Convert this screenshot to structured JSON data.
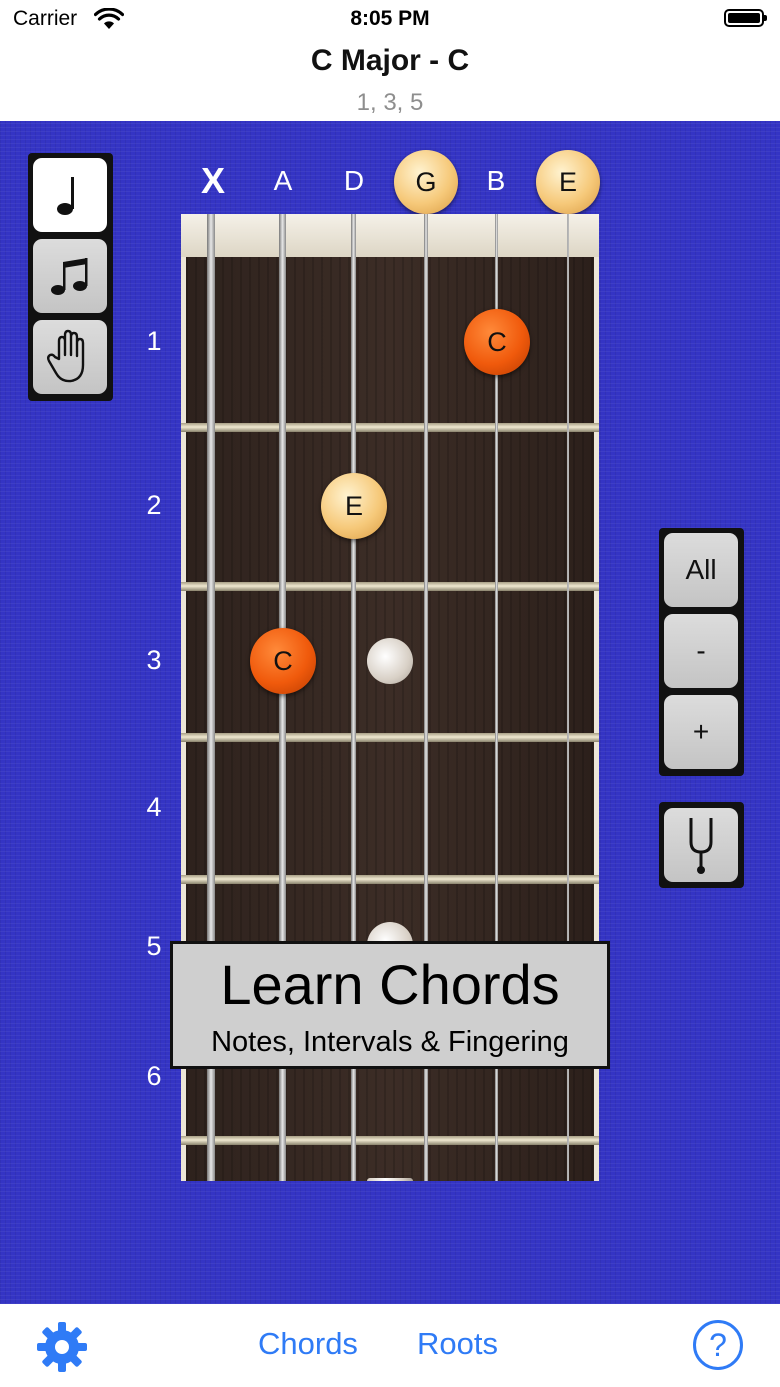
{
  "status_bar": {
    "carrier": "Carrier",
    "time": "8:05 PM"
  },
  "header": {
    "title": "C Major - C",
    "intervals": "1, 3, 5"
  },
  "strings": {
    "labels": [
      "A",
      "D",
      "B"
    ],
    "muted": "X"
  },
  "open_notes": [
    "G",
    "E"
  ],
  "fret_numbers": [
    "1",
    "2",
    "3",
    "4",
    "5",
    "6"
  ],
  "notes": [
    {
      "label": "C",
      "string": "B",
      "fret": 1,
      "role": "root"
    },
    {
      "label": "E",
      "string": "D",
      "fret": 2,
      "role": "third"
    },
    {
      "label": "C",
      "string": "A",
      "fret": 3,
      "role": "root"
    }
  ],
  "right_panel": {
    "all_label": "All",
    "minus_label": "-",
    "plus_label": "+"
  },
  "promo": {
    "title": "Learn Chords",
    "subtitle": "Notes, Intervals & Fingering"
  },
  "tab_bar": {
    "chords_label": "Chords",
    "roots_label": "Roots",
    "help_label": "?"
  },
  "colors": {
    "background": "#3434c4",
    "root_note": "#f05a0c",
    "other_note": "#f6c97a",
    "tab_accent": "#2f7bf6"
  },
  "icons": [
    "wifi-icon",
    "battery-icon",
    "quarter-note-icon",
    "eighth-notes-icon",
    "hand-icon",
    "tuning-fork-icon",
    "gear-icon",
    "help-icon"
  ]
}
